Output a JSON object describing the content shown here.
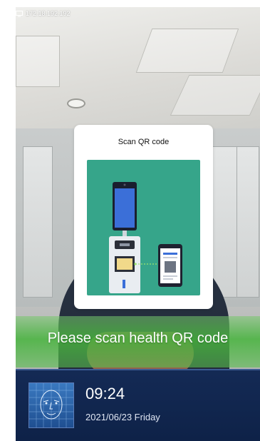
{
  "status_bar": {
    "ip_icon": "monitor-icon",
    "ip_address": "172.18.192.192"
  },
  "qr_prompt": {
    "title": "Scan QR code"
  },
  "banner": {
    "message": "Please scan health QR code"
  },
  "info_panel": {
    "time": "09:24",
    "date": "2021/06/23 Friday",
    "face_icon": "face-scan-icon"
  },
  "colors": {
    "banner_green": "#4cb542",
    "panel_navy": "#112650",
    "illustration_teal": "#36a58a"
  }
}
